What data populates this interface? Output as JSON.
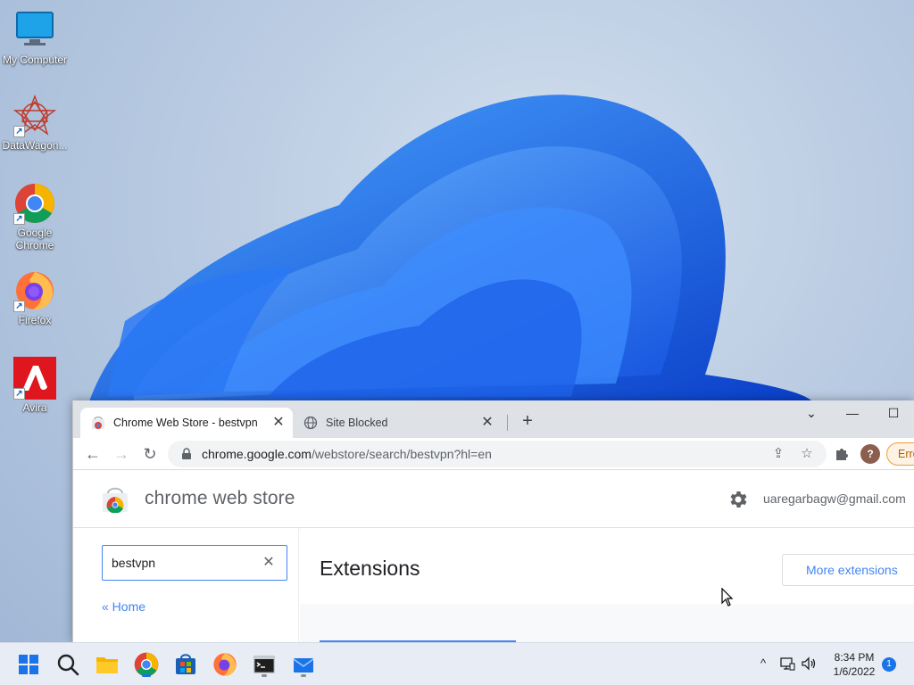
{
  "desktop": {
    "icons": [
      {
        "label": "My Computer",
        "icon": "monitor-icon",
        "shortcut": false
      },
      {
        "label": "DataWagon...",
        "icon": "datawagon-icon",
        "shortcut": true
      },
      {
        "label": "Google Chrome",
        "icon": "chrome-icon",
        "shortcut": true
      },
      {
        "label": "Firefox",
        "icon": "firefox-icon",
        "shortcut": true
      },
      {
        "label": "Avira",
        "icon": "avira-icon",
        "shortcut": true
      }
    ]
  },
  "browser": {
    "tabs": [
      {
        "title": "Chrome Web Store - bestvpn",
        "active": true,
        "icon": "chrome-web-store-icon"
      },
      {
        "title": "Site Blocked",
        "active": false,
        "icon": "globe-icon"
      }
    ],
    "new_tab_label": "+",
    "address": {
      "host": "chrome.google.com",
      "path": "/webstore/search/bestvpn?hl=en"
    },
    "profile_initial": "?",
    "error_label": "Error"
  },
  "store": {
    "title": "chrome web store",
    "account": "uaregarbagw@gmail.com",
    "search_value": "bestvpn",
    "clear_label": "✕",
    "home_link": "« Home",
    "section_heading": "Extensions",
    "more_button": "More extensions"
  },
  "taskbar": {
    "apps": [
      "start-icon",
      "search-icon",
      "file-explorer-icon",
      "chrome-icon",
      "store-icon",
      "firefox-icon",
      "terminal-icon",
      "mail-icon"
    ],
    "time": "8:34 PM",
    "date": "1/6/2022",
    "notification_count": "1"
  },
  "colors": {
    "accent": "#1a73e8",
    "link": "#4285f4",
    "error_border": "#e8a13a"
  }
}
